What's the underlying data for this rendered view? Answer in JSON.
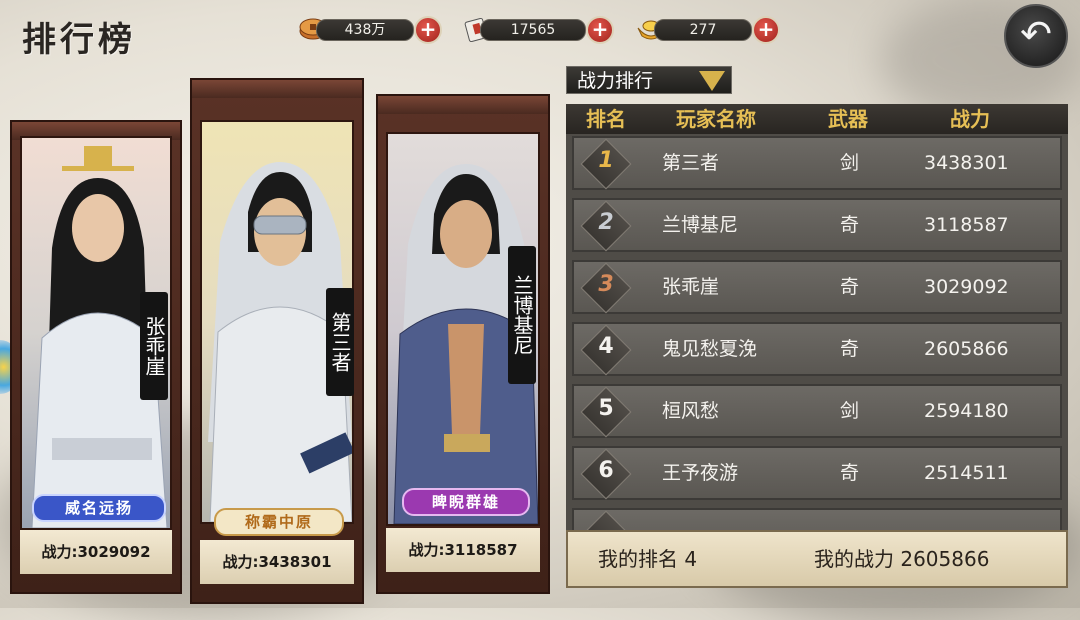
{
  "title": "排行榜",
  "resources": [
    {
      "icon": "coin-icon",
      "value": "438万"
    },
    {
      "icon": "scroll-icon",
      "value": "17565"
    },
    {
      "icon": "gold-ingot-icon",
      "value": "277"
    }
  ],
  "back_icon": "back-arrow-icon",
  "cards": [
    {
      "name": "张乖崖",
      "banner": "威名远扬",
      "power_label": "战力:3029092",
      "banner_color": "#3a56c8"
    },
    {
      "name": "第三者",
      "banner": "称霸中原",
      "power_label": "战力:3438301",
      "banner_color": "#b8742a"
    },
    {
      "name": "兰博基尼",
      "banner": "睥睨群雄",
      "power_label": "战力:3118587",
      "banner_color": "#9b39b0"
    }
  ],
  "dropdown": {
    "label": "战力排行"
  },
  "table": {
    "headers": [
      "排名",
      "玩家名称",
      "武器",
      "战力"
    ],
    "rows": [
      {
        "rank": "1",
        "name": "第三者",
        "weapon": "剑",
        "power": "3438301"
      },
      {
        "rank": "2",
        "name": "兰博基尼",
        "weapon": "奇",
        "power": "3118587"
      },
      {
        "rank": "3",
        "name": "张乖崖",
        "weapon": "奇",
        "power": "3029092"
      },
      {
        "rank": "4",
        "name": "鬼见愁夏浼",
        "weapon": "奇",
        "power": "2605866"
      },
      {
        "rank": "5",
        "name": "桓风愁",
        "weapon": "剑",
        "power": "2594180"
      },
      {
        "rank": "6",
        "name": "王予夜游",
        "weapon": "奇",
        "power": "2514511"
      },
      {
        "rank": "",
        "name": "",
        "weapon": "",
        "power": ""
      }
    ]
  },
  "my_rank": {
    "rank_label": "我的排名 4",
    "power_label": "我的战力 2605866"
  },
  "colors": {
    "gold": "#e6bf55",
    "rank1": "#e9b84a",
    "rank2": "#c9cdd2",
    "rank3": "#d58a5a"
  }
}
